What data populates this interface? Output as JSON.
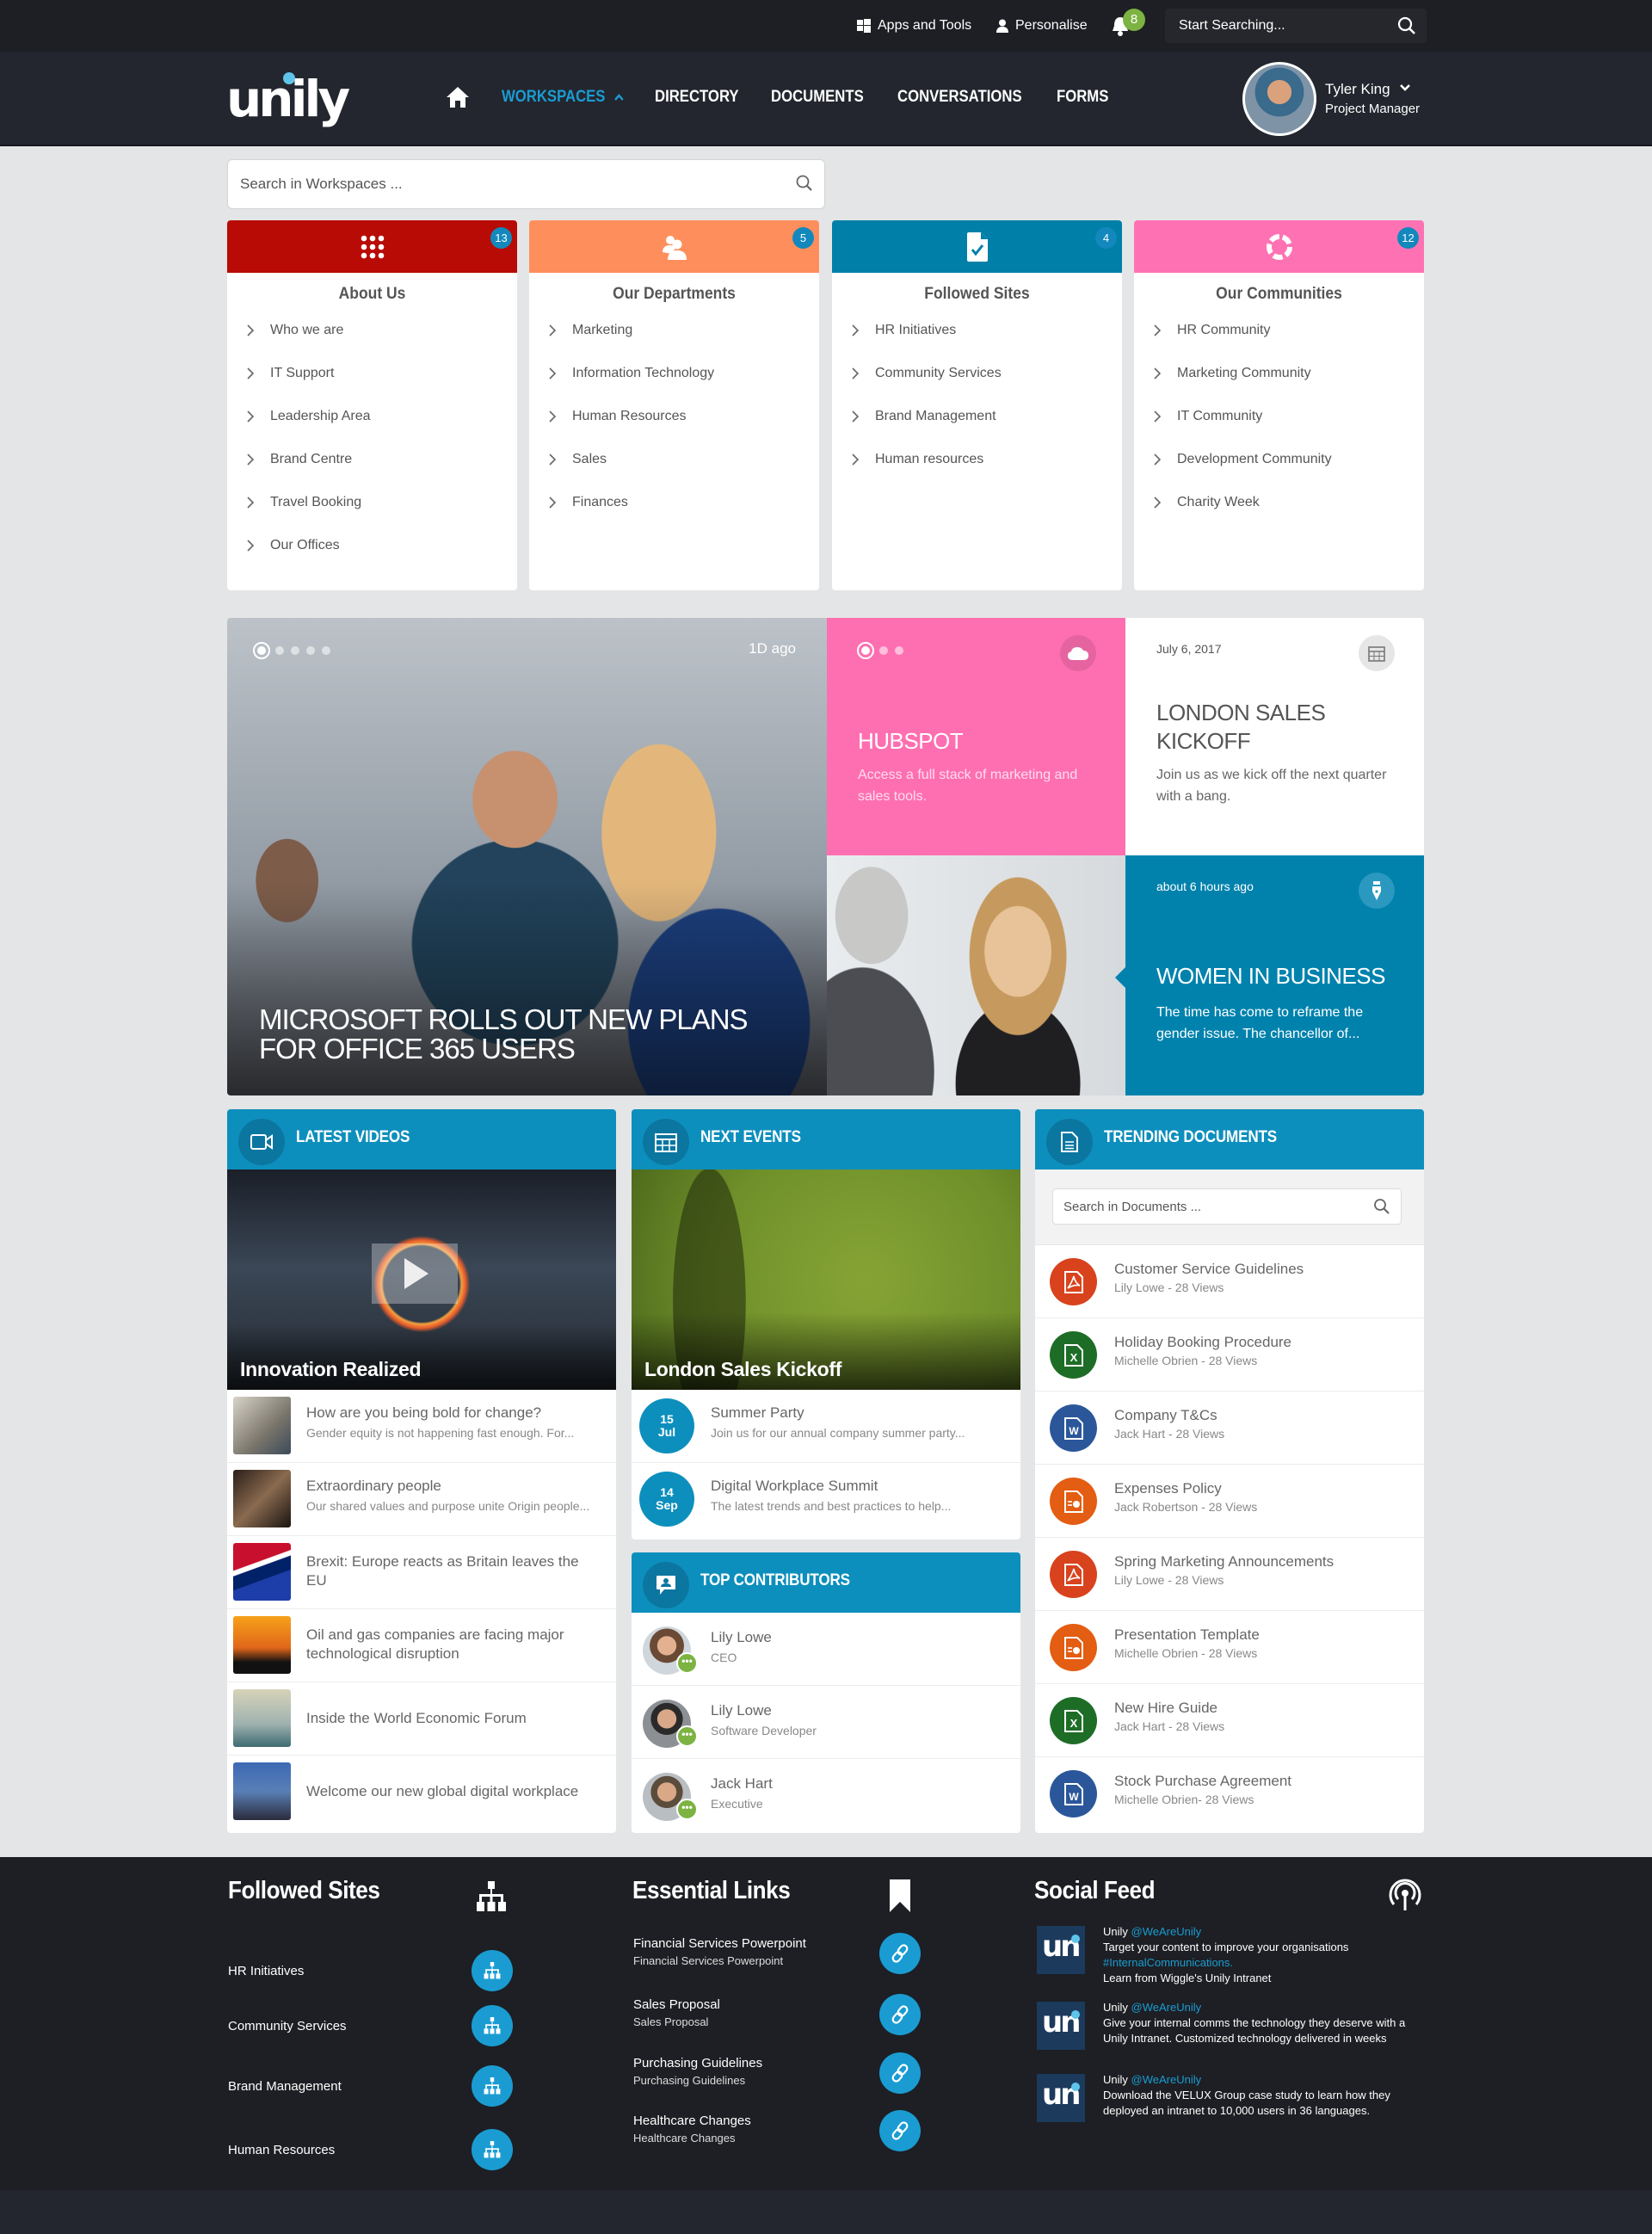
{
  "topbar": {
    "apps_label": "Apps and Tools",
    "personalise_label": "Personalise",
    "notification_count": "8",
    "search_placeholder": "Start Searching..."
  },
  "nav": {
    "logo": "unily",
    "items": [
      {
        "label": "WORKSPACES",
        "active": true
      },
      {
        "label": "DIRECTORY"
      },
      {
        "label": "DOCUMENTS"
      },
      {
        "label": "CONVERSATIONS"
      },
      {
        "label": "FORMS"
      }
    ],
    "user": {
      "name": "Tyler King",
      "role": "Project Manager"
    }
  },
  "workspace_search": {
    "placeholder": "Search in Workspaces ..."
  },
  "workspaces": [
    {
      "title": "About Us",
      "count": "13",
      "color": "#b80b05",
      "icon": "grid-dots-icon",
      "items": [
        "Who we are",
        "IT Support",
        "Leadership Area",
        "Brand Centre",
        "Travel Booking",
        "Our Offices"
      ]
    },
    {
      "title": "Our Departments",
      "count": "5",
      "color": "#fe8f5c",
      "icon": "people-icon",
      "items": [
        "Marketing",
        "Information Technology",
        "Human Resources",
        "Sales",
        "Finances"
      ]
    },
    {
      "title": "Followed Sites",
      "count": "4",
      "color": "#0080a8",
      "icon": "document-check-icon",
      "items": [
        "HR Initiatives",
        "Community Services",
        "Brand Management",
        "Human resources"
      ]
    },
    {
      "title": "Our Communities",
      "count": "12",
      "color": "#fe72b4",
      "icon": "community-ring-icon",
      "items": [
        "HR Community",
        "Marketing Community",
        "IT Community",
        "Development Community",
        "Charity Week"
      ]
    }
  ],
  "hero": {
    "main": {
      "time": "1D ago",
      "title": "MICROSOFT ROLLS OUT NEW PLANS FOR OFFICE 365 USERS",
      "slides": 5,
      "active_slide": 1
    },
    "hubspot": {
      "title": "HUBSPOT",
      "text": "Access a full stack of marketing and sales tools.",
      "slides": 3,
      "active_slide": 1,
      "icon": "cloud-icon"
    },
    "event": {
      "date": "July 6, 2017",
      "title": "LONDON SALES KICKOFF",
      "text": "Join us as we kick off the next quarter with a bang.",
      "icon": "calendar-icon"
    },
    "women": {
      "time": "about 6 hours ago",
      "title": "WOMEN IN BUSINESS",
      "text": "The time has come to reframe the gender issue. The chancellor of...",
      "icon": "pen-nib-icon"
    }
  },
  "latest_videos": {
    "title": "LATEST VIDEOS",
    "featured": "Innovation Realized",
    "items": [
      {
        "title": "How are you being bold for change?",
        "subtitle": "Gender equity is not happening fast enough. For..."
      },
      {
        "title": "Extraordinary people",
        "subtitle": "Our shared values and purpose unite Origin people..."
      },
      {
        "title": "Brexit: Europe reacts as Britain leaves the EU",
        "subtitle": ""
      },
      {
        "title": "Oil and gas companies are facing major technological disruption",
        "subtitle": ""
      },
      {
        "title": "Inside the World Economic Forum",
        "subtitle": ""
      },
      {
        "title": "Welcome our new global digital workplace",
        "subtitle": ""
      }
    ]
  },
  "next_events": {
    "title": "NEXT EVENTS",
    "featured": "London Sales Kickoff",
    "items": [
      {
        "day": "15",
        "month": "Jul",
        "title": "Summer Party",
        "subtitle": "Join us for our annual company summer party..."
      },
      {
        "day": "14",
        "month": "Sep",
        "title": "Digital Workplace Summit",
        "subtitle": "The latest trends and best practices to help..."
      }
    ]
  },
  "top_contributors": {
    "title": "TOP CONTRIBUTORS",
    "items": [
      {
        "name": "Lily Lowe",
        "role": "CEO"
      },
      {
        "name": "Lily Lowe",
        "role": "Software Developer"
      },
      {
        "name": "Jack Hart",
        "role": "Executive"
      }
    ]
  },
  "trending_documents": {
    "title": "TRENDING DOCUMENTS",
    "search_placeholder": "Search in Documents ...",
    "items": [
      {
        "title": "Customer Service Guidelines",
        "meta": "Lily Lowe - 28 Views",
        "type": "pdf",
        "color": "#d8431e"
      },
      {
        "title": "Holiday Booking Procedure",
        "meta": "Michelle Obrien - 28 Views",
        "type": "excel",
        "color": "#1e6d27"
      },
      {
        "title": "Company T&Cs",
        "meta": "Jack Hart - 28 Views",
        "type": "word",
        "color": "#2b579a"
      },
      {
        "title": "Expenses Policy",
        "meta": "Jack Robertson - 28 Views",
        "type": "powerpoint",
        "color": "#e35d12"
      },
      {
        "title": "Spring Marketing Announcements",
        "meta": "Lily Lowe - 28 Views",
        "type": "pdf",
        "color": "#d8431e"
      },
      {
        "title": "Presentation Template",
        "meta": "Michelle Obrien - 28 Views",
        "type": "powerpoint",
        "color": "#e35d12"
      },
      {
        "title": "New Hire Guide",
        "meta": "Jack Hart - 28 Views",
        "type": "excel",
        "color": "#1e6d27"
      },
      {
        "title": "Stock Purchase Agreement",
        "meta": "Michelle Obrien- 28 Views",
        "type": "word",
        "color": "#2b579a"
      }
    ]
  },
  "footer": {
    "followed_sites": {
      "title": "Followed Sites",
      "items": [
        "HR Initiatives",
        "Community Services",
        "Brand Management",
        "Human Resources"
      ]
    },
    "essential_links": {
      "title": "Essential Links",
      "items": [
        {
          "title": "Financial Services Powerpoint",
          "subtitle": "Financial Services Powerpoint"
        },
        {
          "title": "Sales Proposal",
          "subtitle": "Sales Proposal"
        },
        {
          "title": "Purchasing Guidelines",
          "subtitle": "Purchasing Guidelines"
        },
        {
          "title": "Healthcare Changes",
          "subtitle": "Healthcare Changes"
        }
      ]
    },
    "social_feed": {
      "title": "Social Feed",
      "items": [
        {
          "author": "Unily",
          "handle": "@WeAreUnily",
          "text": "Target your content to improve your organisations",
          "tag": "#InternalCommunications.",
          "text2": "Learn from Wiggle's Unily Intranet"
        },
        {
          "author": "Unily",
          "handle": "@WeAreUnily",
          "text": "Give your internal comms the technology they deserve with a Unily Intranet. Customized technology delivered in weeks"
        },
        {
          "author": "Unily",
          "handle": "@WeAreUnily",
          "text": "Download the VELUX Group case study to learn how they deployed an intranet to 10,000 users in 36 languages."
        }
      ]
    }
  },
  "colors": {
    "accent": "#1a9cd2",
    "panel_header": "#0d8fbd",
    "nav_bg": "#23262e",
    "topbar_bg": "#1d1f24",
    "hubspot": "#fe6fb1",
    "women_tile": "#0082ad"
  }
}
